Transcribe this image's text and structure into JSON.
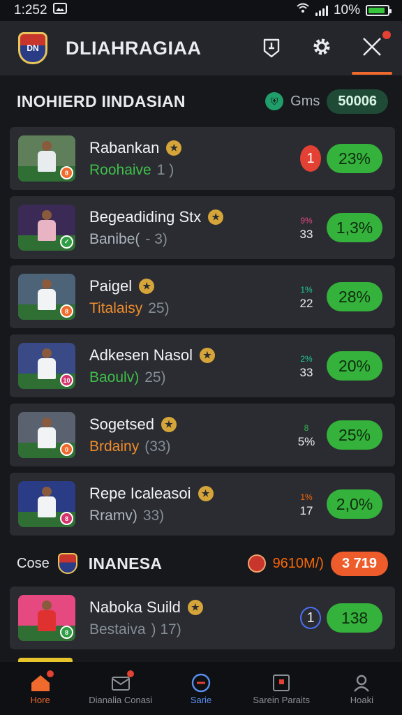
{
  "status": {
    "time": "1:252",
    "battery_text": "10%",
    "battery_level": 0.9
  },
  "header": {
    "title": "DLIAHRAGIAA",
    "logo_text": "DN"
  },
  "section1": {
    "title": "INOHIERD IINDASIAN",
    "meta_label": "Gms",
    "meta_badge": "50006"
  },
  "players1": [
    {
      "name": "Rabankan",
      "sub_a": "Roohaive",
      "sub_b": "1 )",
      "sub_color": "#3fbf4a",
      "pill": "23%",
      "stat_kind": "rank",
      "stat_top": "",
      "stat_bot": "1",
      "stat_color": "#e24133",
      "thumb_badge": "8",
      "badge_color": "#ef6a2c",
      "jersey": "#e9ecef",
      "bg": "#5f7f5a"
    },
    {
      "name": "Begeadiding Stx",
      "sub_a": "Banibe(",
      "sub_b": "- 3)",
      "sub_color": "#adb5bd",
      "pill": "1,3%",
      "stat_kind": "mini",
      "stat_top": "9%",
      "stat_bot": "33",
      "stat_color": "#e64980",
      "thumb_badge": "✓",
      "badge_color": "#2f9e44",
      "jersey": "#e8b4c4",
      "bg": "#3b2a55"
    },
    {
      "name": "Paigel",
      "sub_a": "Titalaisy",
      "sub_b": "25)",
      "sub_color": "#f08c2c",
      "pill": "28%",
      "stat_kind": "mini",
      "stat_top": "1%",
      "stat_bot": "22",
      "stat_color": "#20c997",
      "thumb_badge": "8",
      "badge_color": "#ef6a2c",
      "jersey": "#f1f3f5",
      "bg": "#4d6378"
    },
    {
      "name": "Adkesen Nasol",
      "sub_a": "Baoulv)",
      "sub_b": "25)",
      "sub_color": "#3fbf4a",
      "pill": "20%",
      "stat_kind": "mini",
      "stat_top": "2%",
      "stat_bot": "33",
      "stat_color": "#20c997",
      "thumb_badge": "10",
      "badge_color": "#d6336c",
      "jersey": "#f1f3f5",
      "bg": "#3a4a86"
    },
    {
      "name": "Sogetsed",
      "sub_a": "Brdainy",
      "sub_b": "(33)",
      "sub_color": "#f08c2c",
      "pill": "25%",
      "stat_kind": "mini",
      "stat_top": "8",
      "stat_bot": "5%",
      "stat_color": "#37b24d",
      "thumb_badge": "0",
      "badge_color": "#ef6a2c",
      "jersey": "#f1f3f5",
      "bg": "#5a6270"
    },
    {
      "name": "Repe Icaleasoi",
      "sub_a": "Rramv)",
      "sub_b": "33)",
      "sub_color": "#adb5bd",
      "pill": "2,0%",
      "stat_kind": "mini",
      "stat_top": "1%",
      "stat_bot": "17",
      "stat_color": "#f76707",
      "thumb_badge": "8",
      "badge_color": "#d6336c",
      "jersey": "#f1f3f5",
      "bg": "#2a3c86"
    }
  ],
  "section2": {
    "title_prefix": "Cose",
    "title": "INANESA",
    "meta_label": "9610M/)",
    "meta_badge": "3 719"
  },
  "players2": [
    {
      "name": "Naboka Suild",
      "sub_a": "Bestaiva",
      "sub_b": ") 17)",
      "sub_color": "#868e96",
      "pill": "138",
      "stat_kind": "ring",
      "stat_top": "",
      "stat_bot": "1",
      "stat_color": "#4c6ef5",
      "thumb_badge": "8",
      "badge_color": "#2f9e44",
      "jersey": "#e03131",
      "bg": "#e64980"
    }
  ],
  "nav": [
    {
      "label": "Hore",
      "icon": "home-icon"
    },
    {
      "label": "Dianalia Conasi",
      "icon": "mail-icon"
    },
    {
      "label": "Sarie",
      "icon": "live-icon"
    },
    {
      "label": "Sarein Paraits",
      "icon": "calendar-icon"
    },
    {
      "label": "Hoaki",
      "icon": "profile-icon"
    }
  ]
}
